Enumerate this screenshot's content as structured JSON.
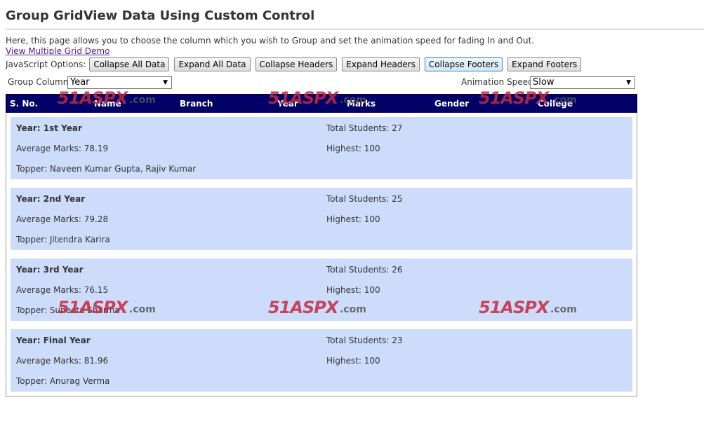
{
  "page": {
    "title": "Group GridView Data Using Custom Control",
    "description": "Here, this page allows you to choose the column which you wish to Group and set the animation speed for fading In and Out.",
    "demo_link": "View Multiple Grid Demo"
  },
  "js_options": {
    "label": "JavaScript Options:",
    "buttons": [
      "Collapse All Data",
      "Expand All Data",
      "Collapse Headers",
      "Expand Headers",
      "Collapse Footers",
      "Expand Footers"
    ]
  },
  "controls": {
    "group_label": "Group Column:",
    "group_value": "Year",
    "speed_label": "Animation Speed:",
    "speed_value": "Slow"
  },
  "grid": {
    "headers": [
      "S. No.",
      "Name",
      "Branch",
      "Year",
      "Marks",
      "Gender",
      "College"
    ],
    "groups": [
      {
        "year": "Year: 1st Year",
        "avg": "Average Marks: 78.19",
        "topper": "Topper: Naveen Kumar Gupta, Rajiv Kumar",
        "total": "Total Students: 27",
        "highest": "Highest: 100"
      },
      {
        "year": "Year: 2nd Year",
        "avg": "Average Marks: 79.28",
        "topper": "Topper: Jitendra Karira",
        "total": "Total Students: 25",
        "highest": "Highest: 100"
      },
      {
        "year": "Year: 3rd Year",
        "avg": "Average Marks: 76.15",
        "topper": "Topper: Suneeta Sharma",
        "total": "Total Students: 26",
        "highest": "Highest: 100"
      },
      {
        "year": "Year: Final Year",
        "avg": "Average Marks: 81.96",
        "topper": "Topper: Anurag Verma",
        "total": "Total Students: 23",
        "highest": "Highest: 100"
      }
    ]
  },
  "watermark": {
    "main": "51ASPX",
    "suffix": ".com"
  }
}
